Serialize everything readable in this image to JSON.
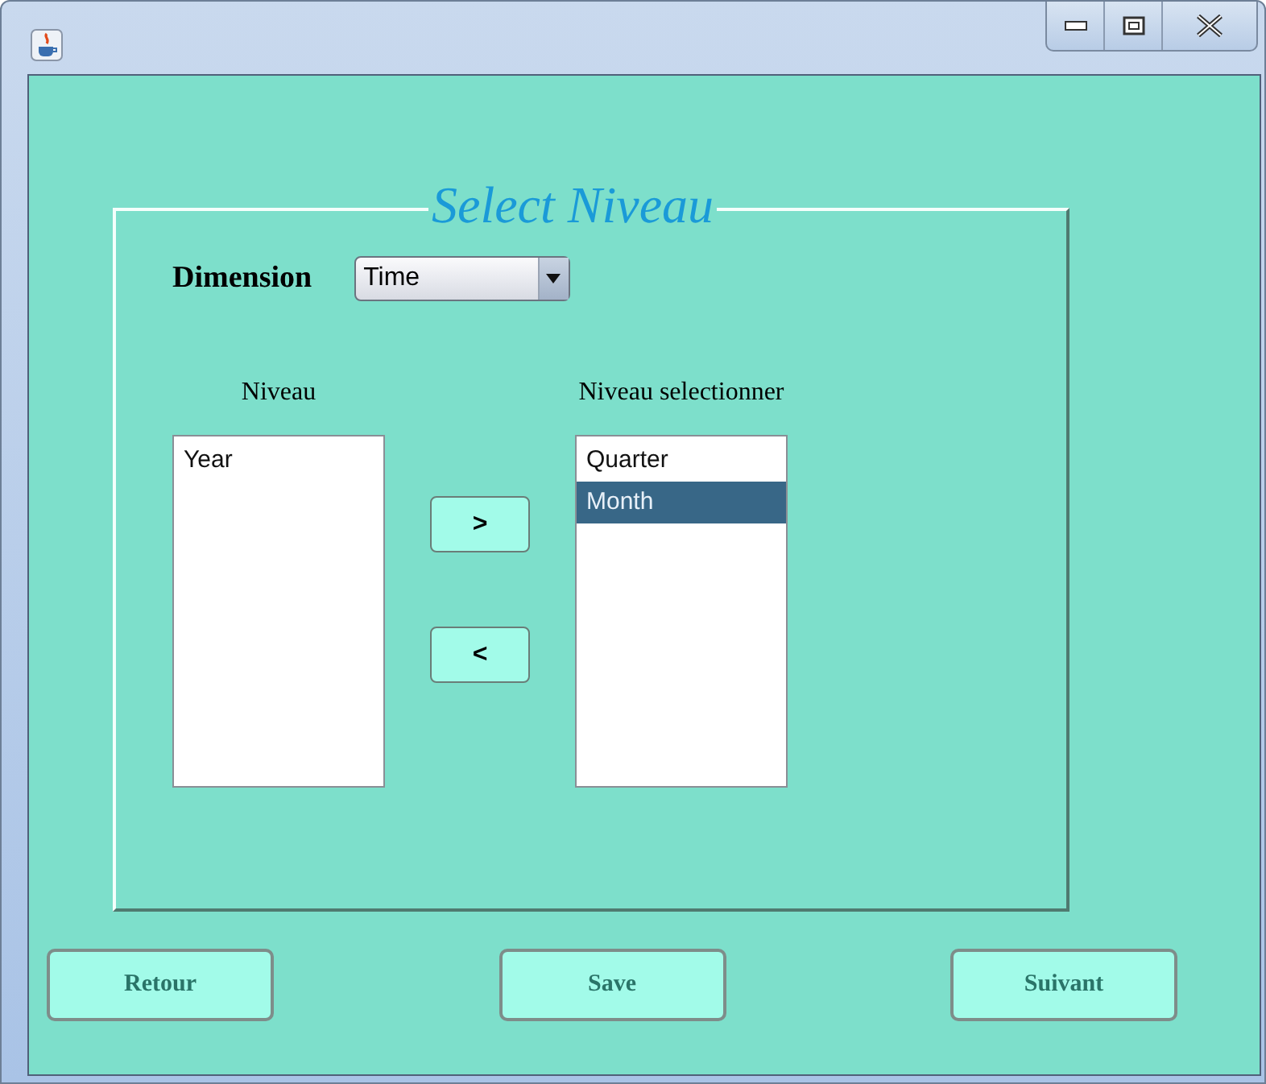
{
  "group": {
    "title": "Select Niveau"
  },
  "dimension": {
    "label": "Dimension",
    "value": "Time"
  },
  "available": {
    "label": "Niveau",
    "items": [
      {
        "text": "Year",
        "selected": false
      }
    ]
  },
  "chosen": {
    "label": "Niveau selectionner",
    "items": [
      {
        "text": "Quarter",
        "selected": false
      },
      {
        "text": "Month",
        "selected": true
      }
    ]
  },
  "move_buttons": [
    ">",
    "<"
  ],
  "buttons": [
    "Retour",
    "Save",
    "Suivant"
  ]
}
